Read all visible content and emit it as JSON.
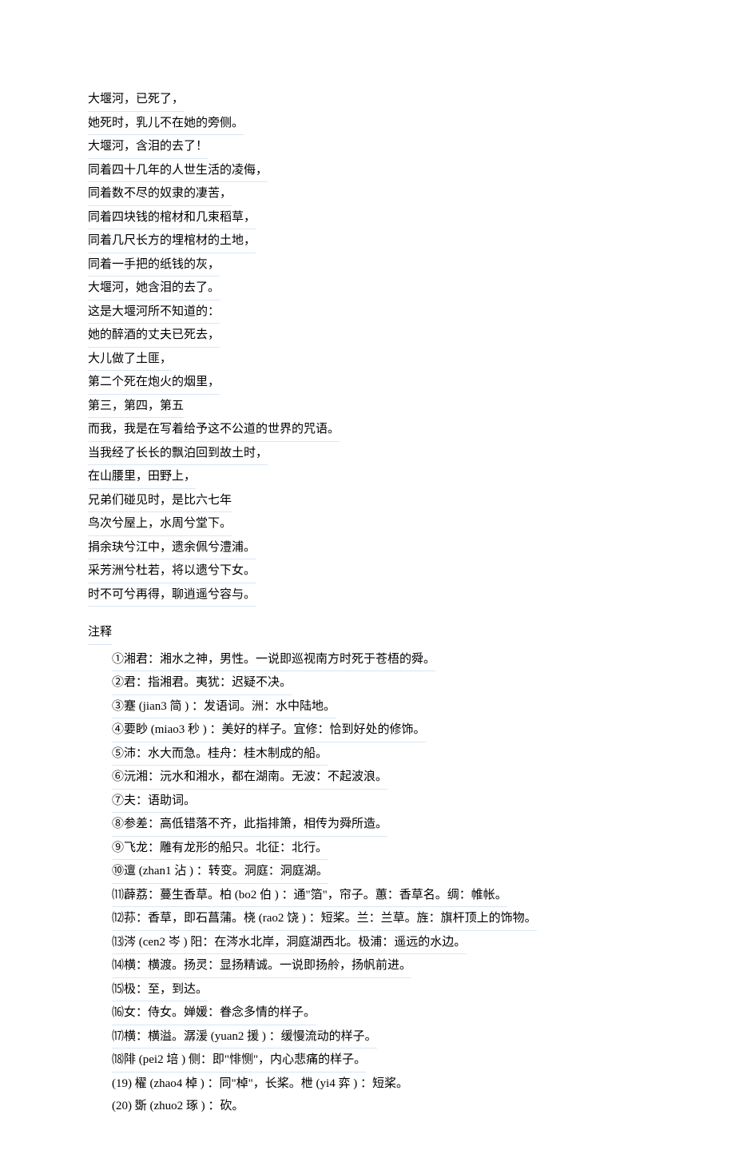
{
  "poem": {
    "lines": [
      "大堰河，已死了，",
      "她死时，乳儿不在她的旁侧。",
      "大堰河，含泪的去了！",
      "同着四十几年的人世生活的凌侮，",
      "同着数不尽的奴隶的凄苦，",
      "同着四块钱的棺材和几束稻草，",
      "同着几尺长方的埋棺材的土地，",
      "同着一手把的纸钱的灰，",
      "大堰河，她含泪的去了。",
      "这是大堰河所不知道的：",
      "她的醉酒的丈夫已死去，",
      "大儿做了土匪，",
      "第二个死在炮火的烟里，",
      "第三，第四，第五",
      "而我，我是在写着给予这不公道的世界的咒语。",
      "当我经了长长的飘泊回到故土时，",
      "在山腰里，田野上，",
      "兄弟们碰见时，是比六七年",
      "鸟次兮屋上，水周兮堂下。",
      "捐余玦兮江中，遗余佩兮澧浦。",
      "采芳洲兮杜若，将以遗兮下女。",
      "时不可兮再得，聊逍遥兮容与。"
    ]
  },
  "notes": {
    "title": "注释",
    "items": [
      "①湘君：湘水之神，男性。一说即巡视南方时死于苍梧的舜。",
      "②君：指湘君。夷犹：迟疑不决。",
      "③蹇 (jian3    简 ) ：发语词。洲：水中陆地。",
      "④要眇 (miao3 秒 ) ：美好的样子。宜修：恰到好处的修饰。",
      "⑤沛：水大而急。桂舟：桂木制成的船。",
      "⑥沅湘：沅水和湘水，都在湖南。无波：不起波浪。",
      "⑦夫：语助词。",
      "⑧参差：高低错落不齐，此指排箫，相传为舜所造。",
      "⑨飞龙：雕有龙形的船只。北征：北行。",
      "⑩邅 (zhan1 沾 ) ：转变。洞庭：洞庭湖。",
      "⑾薜荔：蔓生香草。柏    (bo2 伯 ) ：通\"箔\"，帘子。蕙：香草名。绸：帷帐。",
      "⑿荪：香草，即石菖蒲。桡    (rao2 饶 ) ：短桨。兰：兰草。旌：旗杆顶上的饰物。",
      "⒀涔 (cen2 岑 ) 阳：在涔水北岸，洞庭湖西北。极浦：遥远的水边。",
      "⒁横：横渡。扬灵：显扬精诚。一说即扬舲，扬帆前进。",
      "⒂极：至，到达。",
      "⒃女：侍女。婵媛：眷念多情的样子。",
      "⒄横：横溢。潺湲   (yuan2 援 ) ：缓慢流动的样子。",
      "⒅陫 (pei2    培 ) 侧：即\"悱恻\"，内心悲痛的样子。",
      "(19) 櫂 (zhao4 棹 ) ：同\"棹\"，长桨。枻 (yi4 弈 ) ：短桨。",
      "(20) 斲 (zhuo2 琢 ) ：砍。"
    ],
    "unindentedFrom": 18
  }
}
